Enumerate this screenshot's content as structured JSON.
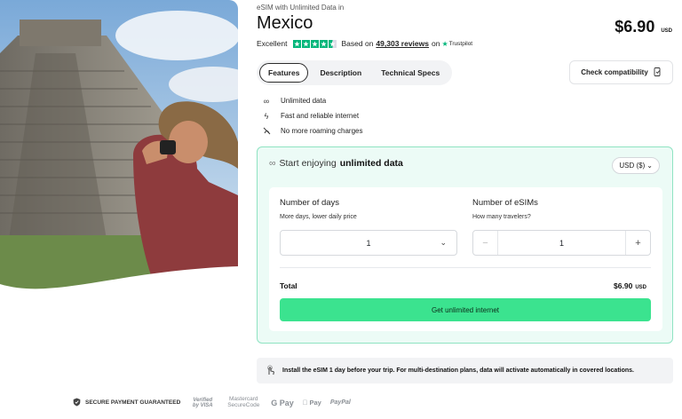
{
  "hero": {
    "image": "tourist-photographing-chichen-itza-pyramid"
  },
  "product": {
    "breadcrumb": "eSIM with Unlimited Data in",
    "title": "Mexico",
    "price": "$6.90",
    "price_currency": "USD"
  },
  "rating": {
    "label": "Excellent",
    "stars": 4.5,
    "based_on": "Based on",
    "reviews": "49,303 reviews",
    "on": "on",
    "provider": "Trustpilot"
  },
  "tabs": [
    {
      "label": "Features",
      "active": true
    },
    {
      "label": "Description",
      "active": false
    },
    {
      "label": "Technical Specs",
      "active": false
    }
  ],
  "compat_button": {
    "label": "Check compatibility",
    "icon": "phone-check-icon"
  },
  "features": [
    {
      "icon": "infinity-icon",
      "label": "Unlimited data"
    },
    {
      "icon": "lightning-icon",
      "label": "Fast and reliable internet"
    },
    {
      "icon": "no-roaming-icon",
      "label": "No more roaming charges"
    }
  ],
  "panel": {
    "heading_prefix": "Start enjoying",
    "heading_bold": "unlimited data",
    "currency_select": "USD ($)",
    "days": {
      "label": "Number of days",
      "sub": "More days, lower daily price",
      "value": "1"
    },
    "esims": {
      "label": "Number of eSIMs",
      "sub": "How many travelers?",
      "value": "1",
      "minus": "−",
      "plus": "+"
    },
    "total_label": "Total",
    "total_value": "$6.90",
    "total_currency": "USD",
    "cta": "Get unlimited internet"
  },
  "notice": "Install the eSIM 1 day before your trip. For multi-destination plans, data will activate automatically in covered locations.",
  "payments": {
    "secure": "SECURE PAYMENT GUARANTEED",
    "methods": [
      "Verified by VISA",
      "Mastercard SecureCode",
      "G Pay",
      "Pay",
      "PayPal"
    ]
  },
  "colors": {
    "accent": "#3be38f",
    "trustpilot": "#00b67a",
    "panel_bg": "#ecfbf6",
    "panel_border": "#8fe3c2"
  }
}
